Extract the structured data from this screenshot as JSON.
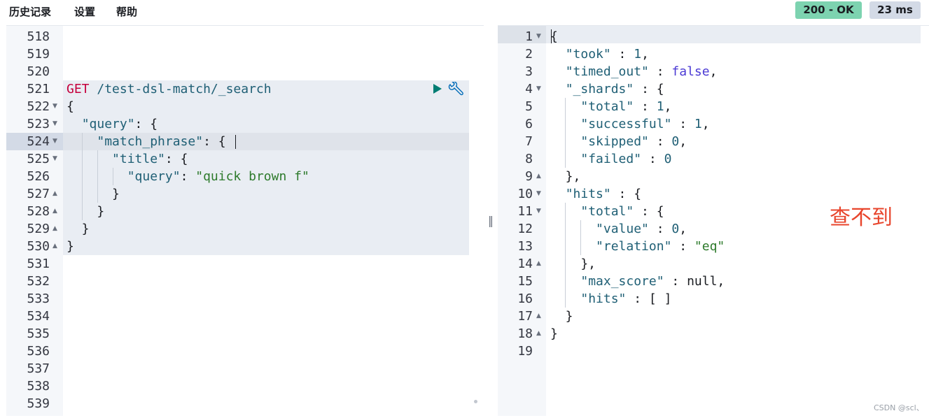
{
  "menu": [
    "历史记录",
    "设置",
    "帮助"
  ],
  "status": {
    "code": "200 - OK",
    "time": "23 ms"
  },
  "request": {
    "line_numbers": [
      "518",
      "519",
      "520",
      "521",
      "522",
      "523",
      "524",
      "525",
      "526",
      "527",
      "528",
      "529",
      "530",
      "531",
      "532",
      "533",
      "534",
      "535",
      "536",
      "537",
      "538",
      "539"
    ],
    "method": "GET",
    "url": " /test-dsl-match/_search",
    "lines": [
      "{",
      "  \"query\": {",
      "    \"match_phrase\": {",
      "      \"title\": {",
      "        \"query\": \"quick brown f\"",
      "      }",
      "    }",
      "  }",
      "}"
    ]
  },
  "response": {
    "line_numbers": [
      "1",
      "2",
      "3",
      "4",
      "5",
      "6",
      "7",
      "8",
      "9",
      "10",
      "11",
      "12",
      "13",
      "14",
      "15",
      "16",
      "17",
      "18",
      "19"
    ],
    "lines": [
      "{",
      "  \"took\" : 1,",
      "  \"timed_out\" : false,",
      "  \"_shards\" : {",
      "    \"total\" : 1,",
      "    \"successful\" : 1,",
      "    \"skipped\" : 0,",
      "    \"failed\" : 0",
      "  },",
      "  \"hits\" : {",
      "    \"total\" : {",
      "      \"value\" : 0,",
      "      \"relation\" : \"eq\"",
      "    },",
      "    \"max_score\" : null,",
      "    \"hits\" : [ ]",
      "  }",
      "}",
      ""
    ]
  },
  "annotation": "查不到",
  "watermark": "CSDN @scl、",
  "colors": {
    "ok_badge": "#7dd3b0",
    "ms_badge": "#d3dae6",
    "method": "#c5003c",
    "string": "#2d7a2b",
    "annotation": "#e8452c"
  },
  "icons": [
    "play-icon",
    "wrench-icon"
  ]
}
